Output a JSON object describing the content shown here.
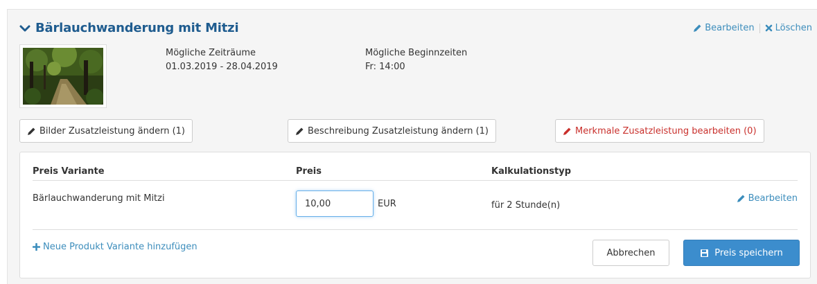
{
  "header": {
    "title": "Bärlauchwanderung mit Mitzi",
    "edit_label": "Bearbeiten",
    "delete_label": "Löschen"
  },
  "info": {
    "periods_label": "Mögliche Zeiträume",
    "periods_value": "01.03.2019 - 28.04.2019",
    "start_label": "Mögliche Beginnzeiten",
    "start_value": "Fr: 14:00"
  },
  "buttons": {
    "images": "Bilder Zusatzleistung ändern (1)",
    "description": "Beschreibung Zusatzleistung ändern (1)",
    "features": "Merkmale Zusatzleistung bearbeiten (0)"
  },
  "table": {
    "headers": [
      "Preis Variante",
      "Preis",
      "Kalkulationstyp"
    ],
    "rows": [
      {
        "variant": "Bärlauchwanderung mit Mitzi",
        "price": "10,00",
        "currency": "EUR",
        "calc_type": "für 2 Stunde(n)",
        "edit_label": "Bearbeiten"
      }
    ]
  },
  "footer": {
    "add_variant": "Neue Produkt Variante hinzufügen",
    "cancel": "Abbrechen",
    "save": "Preis speichern"
  },
  "icons": {
    "chevron": "chevron-down-icon",
    "pencil": "pencil-icon",
    "delete": "times-icon",
    "plus": "plus-icon",
    "save": "floppy-disk-icon"
  },
  "colors": {
    "title": "#1f5c8f",
    "link": "#3c8dbc",
    "danger": "#c9302c",
    "primary": "#3c8dcd",
    "panel_bg": "#f5f5f5"
  }
}
